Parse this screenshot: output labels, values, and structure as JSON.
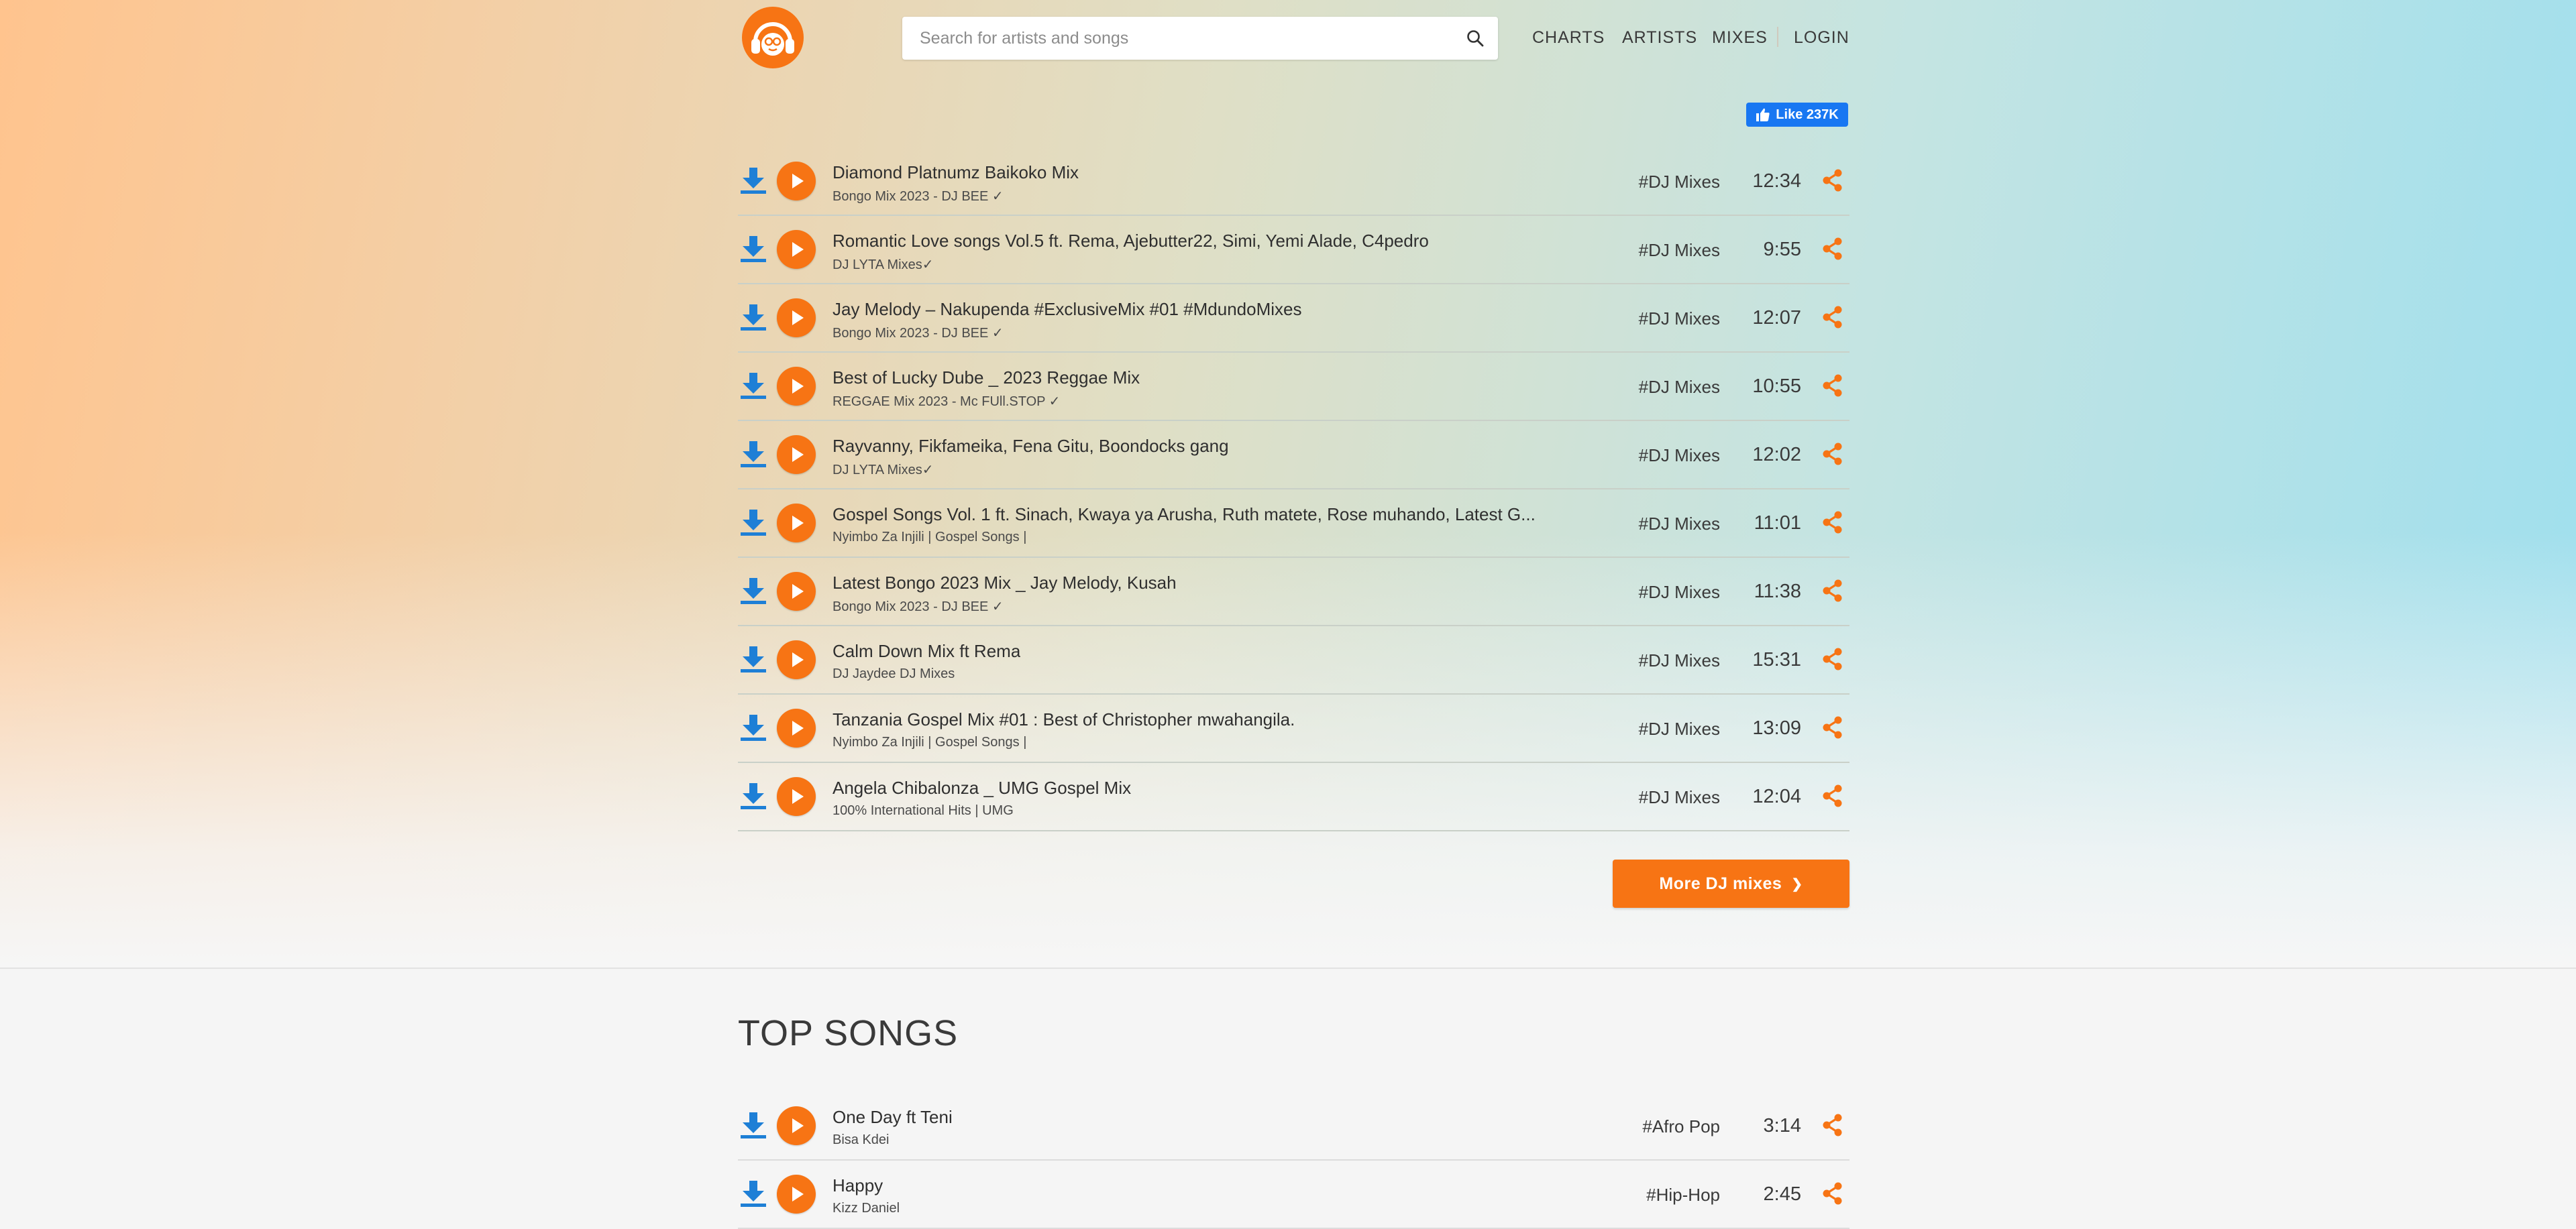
{
  "search": {
    "placeholder": "Search for artists and songs"
  },
  "nav": {
    "charts": "CHARTS",
    "artists": "ARTISTS",
    "mixes": "MIXES",
    "login": "LOGIN"
  },
  "fb_like": {
    "label": "Like 237K"
  },
  "mixes": [
    {
      "title": "Diamond Platnumz Baikoko Mix",
      "subtitle": "Bongo Mix 2023 - DJ BEE ✓",
      "tag": "#DJ Mixes",
      "duration": "12:34"
    },
    {
      "title": "Romantic Love songs Vol.5 ft. Rema, Ajebutter22, Simi, Yemi Alade, C4pedro",
      "subtitle": "DJ LYTA Mixes✓",
      "tag": "#DJ Mixes",
      "duration": "9:55"
    },
    {
      "title": "Jay Melody – Nakupenda #ExclusiveMix #01 #MdundoMixes",
      "subtitle": "Bongo Mix 2023 - DJ BEE ✓",
      "tag": "#DJ Mixes",
      "duration": "12:07"
    },
    {
      "title": "Best of Lucky Dube _ 2023 Reggae Mix",
      "subtitle": "REGGAE Mix 2023 - Mc FUll.STOP ✓",
      "tag": "#DJ Mixes",
      "duration": "10:55"
    },
    {
      "title": "Rayvanny, Fikfameika, Fena Gitu, Boondocks gang",
      "subtitle": "DJ LYTA Mixes✓",
      "tag": "#DJ Mixes",
      "duration": "12:02"
    },
    {
      "title": "Gospel Songs Vol. 1 ft. Sinach, Kwaya ya Arusha, Ruth matete, Rose muhando, Latest G...",
      "subtitle": "Nyimbo Za Injili | Gospel Songs |",
      "tag": "#DJ Mixes",
      "duration": "11:01"
    },
    {
      "title": "Latest Bongo 2023 Mix _ Jay Melody, Kusah",
      "subtitle": "Bongo Mix 2023 - DJ BEE ✓",
      "tag": "#DJ Mixes",
      "duration": "11:38"
    },
    {
      "title": "Calm Down Mix ft Rema",
      "subtitle": "DJ Jaydee DJ Mixes",
      "tag": "#DJ Mixes",
      "duration": "15:31"
    },
    {
      "title": "Tanzania Gospel Mix #01 : Best of Christopher mwahangila.",
      "subtitle": "Nyimbo Za Injili | Gospel Songs |",
      "tag": "#DJ Mixes",
      "duration": "13:09"
    },
    {
      "title": "Angela Chibalonza _ UMG Gospel Mix",
      "subtitle": "100% International Hits | UMG",
      "tag": "#DJ Mixes",
      "duration": "12:04"
    }
  ],
  "more_button": {
    "label": "More DJ mixes",
    "arrow": "❯"
  },
  "top_songs": {
    "heading": "TOP SONGS",
    "items": [
      {
        "title": "One Day ft Teni",
        "subtitle": "Bisa Kdei",
        "tag": "#Afro Pop",
        "duration": "3:14"
      },
      {
        "title": "Happy",
        "subtitle": "Kizz Daniel",
        "tag": "#Hip-Hop",
        "duration": "2:45"
      }
    ]
  },
  "icons": {
    "logo": "headphones-logo-icon",
    "search": "search-icon",
    "download": "download-icon",
    "play": "play-icon",
    "share": "share-icon",
    "like": "thumbs-up-icon"
  },
  "colors": {
    "accent": "#f77414",
    "download_blue": "#1e7fd6",
    "facebook": "#1877f2"
  }
}
